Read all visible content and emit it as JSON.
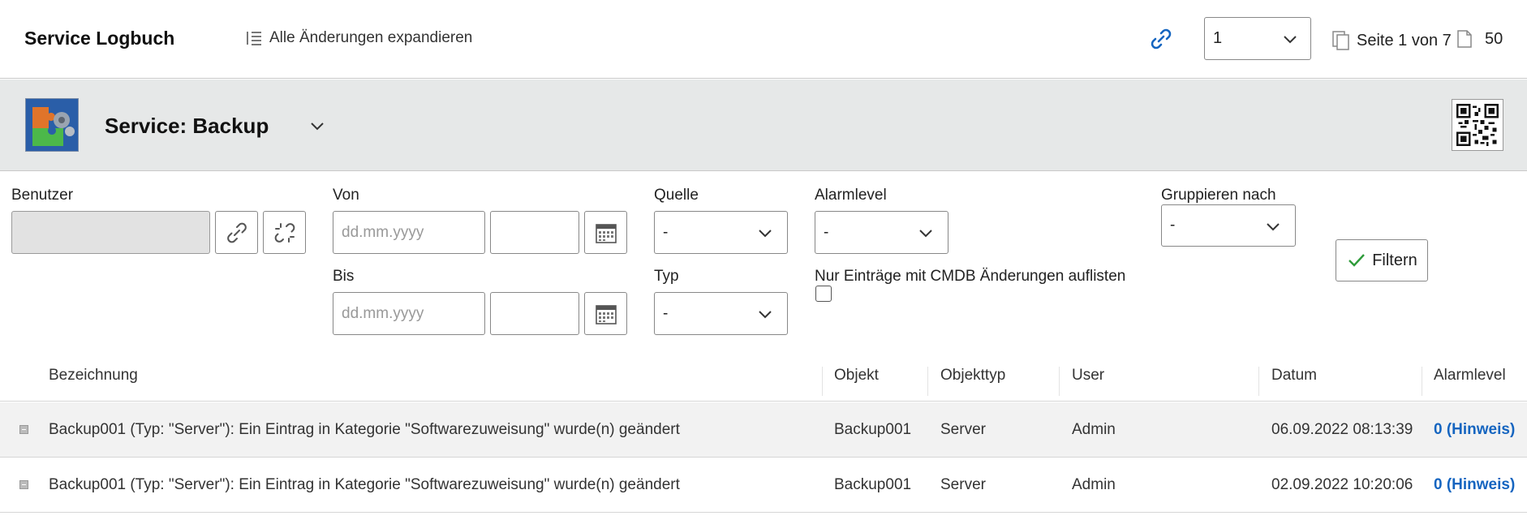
{
  "header": {
    "title": "Service Logbuch",
    "expand_all_label": "Alle Änderungen expandieren",
    "page_select_value": "1",
    "page_info": "Seite 1 von 7",
    "per_page": "50"
  },
  "service": {
    "title": "Service: Backup"
  },
  "filters": {
    "benutzer_label": "Benutzer",
    "von_label": "Von",
    "bis_label": "Bis",
    "date_placeholder": "dd.mm.yyyy",
    "quelle_label": "Quelle",
    "quelle_value": "-",
    "typ_label": "Typ",
    "typ_value": "-",
    "alarmlevel_label": "Alarmlevel",
    "alarmlevel_value": "-",
    "cmdb_only_label": "Nur Einträge mit CMDB Änderungen auflisten",
    "gruppieren_label": "Gruppieren nach",
    "gruppieren_value": "-",
    "filter_button": "Filtern"
  },
  "table": {
    "columns": [
      "Bezeichnung",
      "Objekt",
      "Objekttyp",
      "User",
      "Datum",
      "Alarmlevel"
    ],
    "rows": [
      {
        "bezeichnung": "Backup001 (Typ: \"Server\"): Ein Eintrag in Kategorie \"Softwarezuweisung\" wurde(n) geändert",
        "objekt": "Backup001",
        "objekttyp": "Server",
        "user": "Admin",
        "datum": "06.09.2022 08:13:39",
        "alarmlevel": "0 (Hinweis)"
      },
      {
        "bezeichnung": "Backup001 (Typ: \"Server\"): Ein Eintrag in Kategorie \"Softwarezuweisung\" wurde(n) geändert",
        "objekt": "Backup001",
        "objekttyp": "Server",
        "user": "Admin",
        "datum": "02.09.2022 10:20:06",
        "alarmlevel": "0 (Hinweis)"
      }
    ]
  },
  "colors": {
    "accent_link": "#1565c0",
    "service_bar_bg": "#e6e8e8",
    "filter_check": "#2e9b3a"
  }
}
